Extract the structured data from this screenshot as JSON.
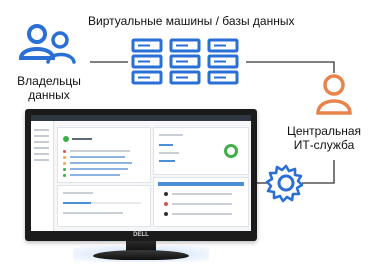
{
  "diagram": {
    "title": "Виртуальные машины / базы данных",
    "owners_label": "Владельцы данных",
    "it_label": "Центральная ИТ-служба",
    "monitor_brand": "DELL"
  },
  "colors": {
    "users_icon": "#2a6fd6",
    "servers_icon": "#2a6fd6",
    "it_person_icon": "#e8834a",
    "gear_icon": "#2a6fd6",
    "connector_line": "#333333"
  },
  "icons": {
    "owners": "users-group-icon",
    "servers": "server-stack-icon",
    "it": "person-icon",
    "settings": "gear-icon"
  }
}
